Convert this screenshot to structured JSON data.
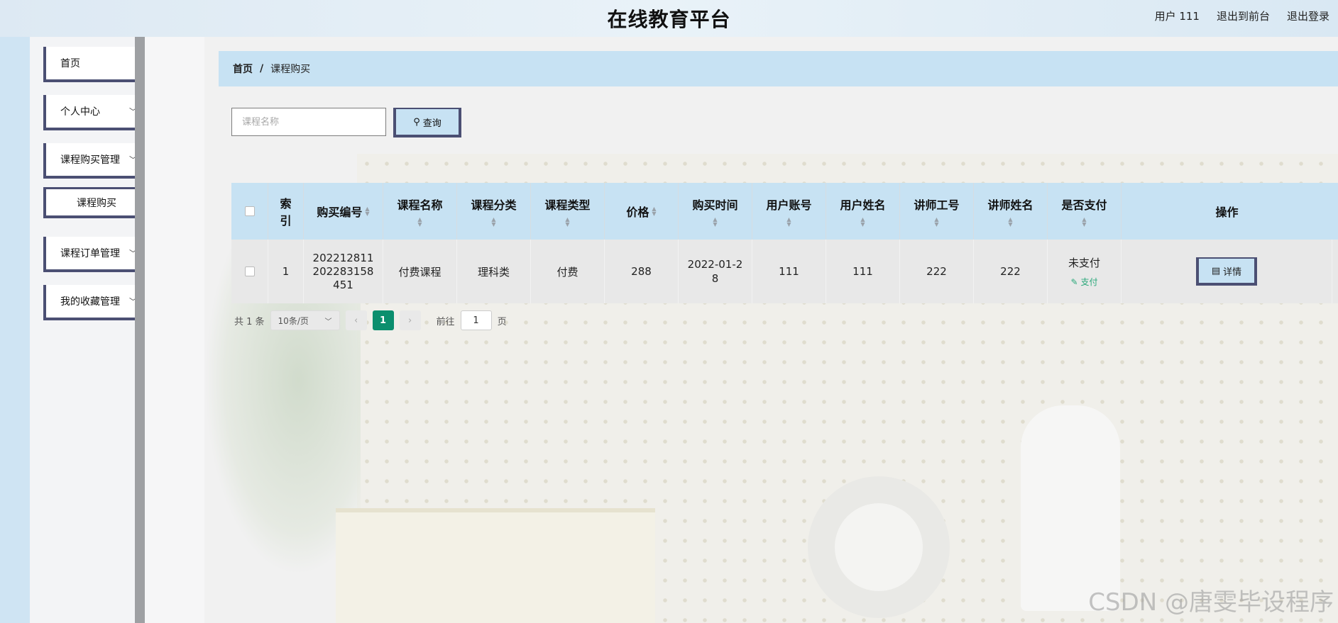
{
  "header": {
    "title": "在线教育平台",
    "user_label": "用户 111",
    "front_label": "退出到前台",
    "logout_label": "退出登录"
  },
  "sidebar": {
    "items": [
      {
        "label": "首页",
        "has_chevron": false
      },
      {
        "label": "个人中心",
        "has_chevron": true
      },
      {
        "label": "课程购买管理",
        "has_chevron": true
      },
      {
        "label": "课程购买",
        "has_chevron": false
      },
      {
        "label": "课程订单管理",
        "has_chevron": true
      },
      {
        "label": "我的收藏管理",
        "has_chevron": true
      }
    ]
  },
  "breadcrumb": {
    "home": "首页",
    "separator": "/",
    "current": "课程购买"
  },
  "search": {
    "placeholder": "课程名称",
    "button_label": "查询",
    "button_icon": "search-icon"
  },
  "table": {
    "headers": [
      "索引",
      "购买编号",
      "课程名称",
      "课程分类",
      "课程类型",
      "价格",
      "购买时间",
      "用户账号",
      "用户姓名",
      "讲师工号",
      "讲师姓名",
      "是否支付",
      "操作"
    ],
    "rows": [
      {
        "index": "1",
        "purchase_no": "202212811 202283158 451",
        "course_name": "付费课程",
        "category": "理科类",
        "type": "付费",
        "price": "288",
        "purchase_time": "2022-01-2 8",
        "user_account": "111",
        "user_name": "111",
        "teacher_no": "222",
        "teacher_name": "222",
        "paid_status": "未支付",
        "pay_action": "支付",
        "detail_label": "详情"
      }
    ]
  },
  "pagination": {
    "total": "共 1 条",
    "page_size": "10条/页",
    "current_page": "1",
    "goto_prefix": "前往",
    "goto_value": "1",
    "goto_suffix": "页"
  },
  "watermark": "CSDN @唐雯毕设程序",
  "colors": {
    "accent_blue": "#c7e2f3",
    "border_navy": "#4b4f73",
    "page_active": "#0c8f6e",
    "pay_link": "#2aa87a"
  }
}
